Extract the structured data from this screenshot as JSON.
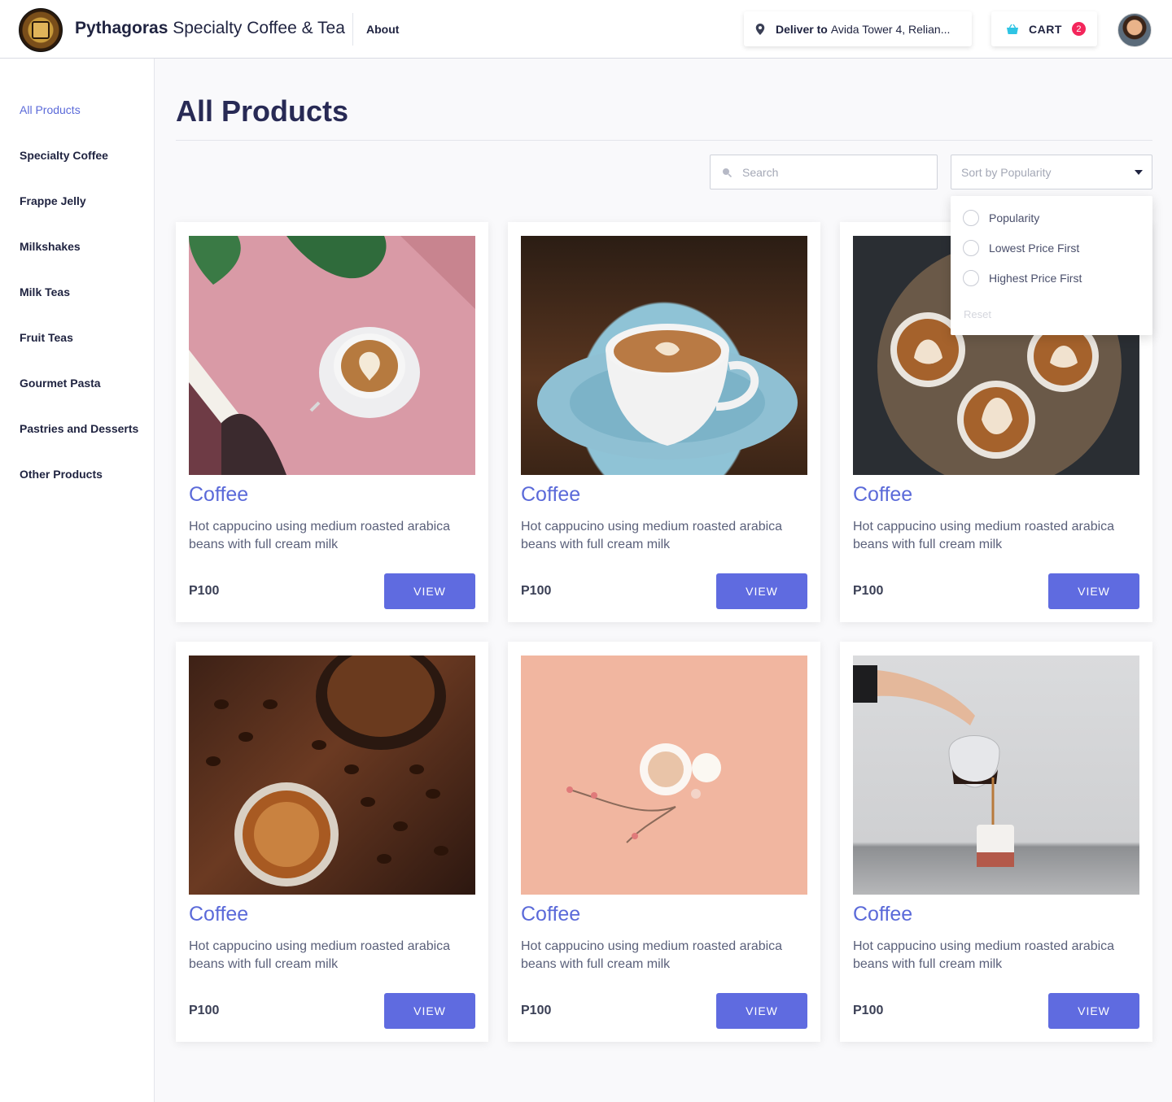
{
  "header": {
    "brand_bold": "Pythagoras",
    "brand_rest": " Specialty Coffee & Tea",
    "nav_about": "About",
    "deliver_label": "Deliver to",
    "deliver_address": "Avida Tower 4, Relian...",
    "cart_label": "CART",
    "cart_count": "2"
  },
  "sidebar": {
    "items": [
      {
        "label": "All Products",
        "active": true
      },
      {
        "label": "Specialty Coffee"
      },
      {
        "label": "Frappe Jelly"
      },
      {
        "label": "Milkshakes"
      },
      {
        "label": "Milk Teas"
      },
      {
        "label": "Fruit Teas"
      },
      {
        "label": "Gourmet Pasta"
      },
      {
        "label": "Pastries and Desserts"
      },
      {
        "label": "Other Products"
      }
    ]
  },
  "main": {
    "title": "All Products",
    "search_placeholder": "Search",
    "sort_placeholder": "Sort by Popularity",
    "sort_options": [
      "Popularity",
      "Lowest Price First",
      "Highest Price First"
    ],
    "sort_reset": "Reset"
  },
  "products": [
    {
      "name": "Coffee",
      "description": "Hot cappucino using medium roasted arabica beans with full cream milk",
      "price": "P100",
      "button": "VIEW"
    },
    {
      "name": "Coffee",
      "description": "Hot cappucino using medium roasted arabica beans with full cream milk",
      "price": "P100",
      "button": "VIEW"
    },
    {
      "name": "Coffee",
      "description": "Hot cappucino using medium roasted arabica beans with full cream milk",
      "price": "P100",
      "button": "VIEW"
    },
    {
      "name": "Coffee",
      "description": "Hot cappucino using medium roasted arabica beans with full cream milk",
      "price": "P100",
      "button": "VIEW"
    },
    {
      "name": "Coffee",
      "description": "Hot cappucino using medium roasted arabica beans with full cream milk",
      "price": "P100",
      "button": "VIEW"
    },
    {
      "name": "Coffee",
      "description": "Hot cappucino using medium roasted arabica beans with full cream milk",
      "price": "P100",
      "button": "VIEW"
    }
  ],
  "colors": {
    "accent": "#5f6be0",
    "link": "#5b6ad9",
    "badge": "#f3265b",
    "title": "#282a55"
  },
  "icons": [
    "map-pin-icon",
    "basket-icon",
    "search-icon",
    "chevron-down-icon"
  ]
}
